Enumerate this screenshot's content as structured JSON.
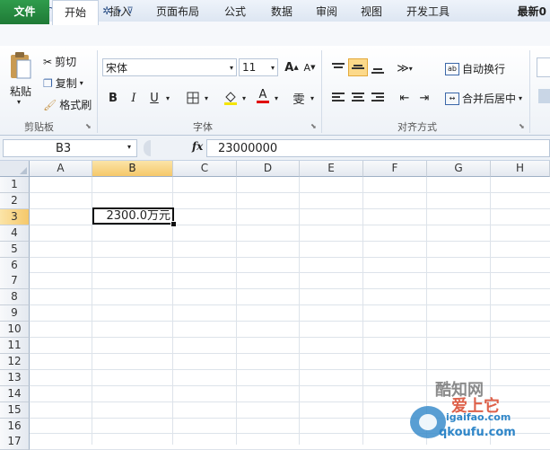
{
  "titlebar": {
    "title": "最新0"
  },
  "tabs": [
    {
      "label": "文件"
    },
    {
      "label": "开始"
    },
    {
      "label": "插入"
    },
    {
      "label": "页面布局"
    },
    {
      "label": "公式"
    },
    {
      "label": "数据"
    },
    {
      "label": "审阅"
    },
    {
      "label": "视图"
    },
    {
      "label": "开发工具"
    }
  ],
  "clipboard": {
    "paste": "粘贴",
    "cut": "剪切",
    "copy": "复制",
    "format_painter": "格式刷",
    "group": "剪贴板"
  },
  "font": {
    "name": "宋体",
    "size": "11",
    "bold": "B",
    "italic": "I",
    "underline": "U",
    "wen": "雯",
    "font_color_glyph": "A",
    "grow": "A",
    "shrink": "A",
    "group": "字体"
  },
  "align": {
    "wrap": "自动换行",
    "merge": "合并后居中",
    "group": "对齐方式"
  },
  "formula_bar": {
    "name_box": "B3",
    "fx": "fx",
    "value": "23000000"
  },
  "columns": [
    "A",
    "B",
    "C",
    "D",
    "E",
    "F",
    "G",
    "H"
  ],
  "rows": [
    "1",
    "2",
    "3",
    "4",
    "5",
    "6",
    "7",
    "8",
    "9",
    "10",
    "11",
    "12",
    "13",
    "14",
    "15",
    "16",
    "17"
  ],
  "cells": {
    "B3": "2300.0万元"
  },
  "watermark": {
    "line1": "酷知网",
    "line2": "爱上它",
    "url": "igaifao.com",
    "url2": "qkoufu.com"
  },
  "colors": {
    "file_tab": "#1f7a36",
    "selection_header": "#f5c86a",
    "accent": "#2b4f86"
  }
}
